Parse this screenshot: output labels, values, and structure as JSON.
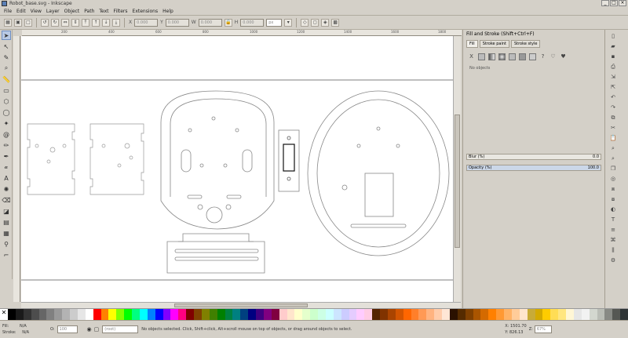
{
  "window": {
    "title": "Robot_base.svg - Inkscape",
    "controls": [
      "_",
      "□",
      "×"
    ]
  },
  "menu": [
    "File",
    "Edit",
    "View",
    "Layer",
    "Object",
    "Path",
    "Text",
    "Filters",
    "Extensions",
    "Help"
  ],
  "command_bar": {
    "x_label": "X",
    "x_value": "0.000",
    "y_label": "Y",
    "y_value": "0.000",
    "w_label": "W",
    "w_value": "0.000",
    "h_label": "H",
    "h_value": "0.000",
    "units": "px"
  },
  "ruler_labels": [
    "200",
    "400",
    "600",
    "800",
    "1000",
    "1200",
    "1400",
    "1600",
    "1800"
  ],
  "fill_stroke": {
    "title": "Fill and Stroke (Shift+Ctrl+F)",
    "tabs": [
      "Fill",
      "Stroke paint",
      "Stroke style"
    ],
    "message": "No objects",
    "blur_label": "Blur (%)",
    "blur_value": "0.0",
    "opacity_label": "Opacity (%)",
    "opacity_value": "100.0"
  },
  "status": {
    "fill_label": "Fill:",
    "fill_value": "N/A",
    "stroke_label": "Stroke:",
    "stroke_value": "N/A",
    "opacity_label": "O:",
    "opacity_value": "100",
    "layer": "(root)",
    "message": "No objects selected. Click, Shift+click, Alt+scroll mouse on top of objects, or drag around objects to select.",
    "x_label": "X:",
    "x_value": "1501.70",
    "y_label": "Y:",
    "y_value": "826.13",
    "zoom_label": "Z:",
    "zoom_value": "67%"
  },
  "palette": [
    "#000000",
    "#1a1a1a",
    "#333333",
    "#4d4d4d",
    "#666666",
    "#808080",
    "#999999",
    "#b3b3b3",
    "#cccccc",
    "#e6e6e6",
    "#ffffff",
    "#ff0000",
    "#ff8000",
    "#ffff00",
    "#80ff00",
    "#00ff00",
    "#00ff80",
    "#00ffff",
    "#0080ff",
    "#0000ff",
    "#8000ff",
    "#ff00ff",
    "#ff0080",
    "#800000",
    "#804000",
    "#808000",
    "#408000",
    "#008000",
    "#008040",
    "#008080",
    "#004080",
    "#000080",
    "#400080",
    "#800080",
    "#800040",
    "#ffcccc",
    "#ffe5cc",
    "#ffffcc",
    "#e5ffcc",
    "#ccffcc",
    "#ccffe5",
    "#ccffff",
    "#cce5ff",
    "#ccccff",
    "#e5ccff",
    "#ffccff",
    "#ffcce5",
    "#552200",
    "#803300",
    "#aa4400",
    "#d45500",
    "#ff6600",
    "#ff7f2a",
    "#ff9955",
    "#ffb380",
    "#ffccaa",
    "#ffe6d5",
    "#2b1100",
    "#552b00",
    "#804000",
    "#aa5500",
    "#d46a00",
    "#ff8000",
    "#ff9933",
    "#ffb366",
    "#ffcc99",
    "#ffe5cc",
    "#c8ab37",
    "#d4aa00",
    "#ffcc00",
    "#ffdd55",
    "#ffe680",
    "#fff6d5",
    "#e6e6e6",
    "#f2f2f2",
    "#d3d7cf",
    "#babdb6",
    "#888a85",
    "#555753",
    "#2e3436"
  ]
}
